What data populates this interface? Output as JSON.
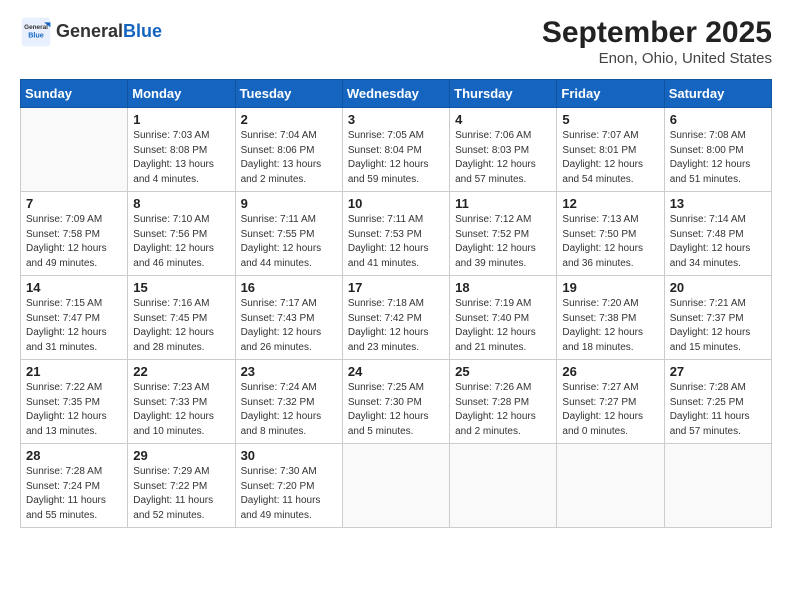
{
  "header": {
    "logo_line1": "General",
    "logo_line2": "Blue",
    "month_year": "September 2025",
    "location": "Enon, Ohio, United States"
  },
  "days_of_week": [
    "Sunday",
    "Monday",
    "Tuesday",
    "Wednesday",
    "Thursday",
    "Friday",
    "Saturday"
  ],
  "weeks": [
    [
      {
        "day": "",
        "info": ""
      },
      {
        "day": "1",
        "info": "Sunrise: 7:03 AM\nSunset: 8:08 PM\nDaylight: 13 hours\nand 4 minutes."
      },
      {
        "day": "2",
        "info": "Sunrise: 7:04 AM\nSunset: 8:06 PM\nDaylight: 13 hours\nand 2 minutes."
      },
      {
        "day": "3",
        "info": "Sunrise: 7:05 AM\nSunset: 8:04 PM\nDaylight: 12 hours\nand 59 minutes."
      },
      {
        "day": "4",
        "info": "Sunrise: 7:06 AM\nSunset: 8:03 PM\nDaylight: 12 hours\nand 57 minutes."
      },
      {
        "day": "5",
        "info": "Sunrise: 7:07 AM\nSunset: 8:01 PM\nDaylight: 12 hours\nand 54 minutes."
      },
      {
        "day": "6",
        "info": "Sunrise: 7:08 AM\nSunset: 8:00 PM\nDaylight: 12 hours\nand 51 minutes."
      }
    ],
    [
      {
        "day": "7",
        "info": "Sunrise: 7:09 AM\nSunset: 7:58 PM\nDaylight: 12 hours\nand 49 minutes."
      },
      {
        "day": "8",
        "info": "Sunrise: 7:10 AM\nSunset: 7:56 PM\nDaylight: 12 hours\nand 46 minutes."
      },
      {
        "day": "9",
        "info": "Sunrise: 7:11 AM\nSunset: 7:55 PM\nDaylight: 12 hours\nand 44 minutes."
      },
      {
        "day": "10",
        "info": "Sunrise: 7:11 AM\nSunset: 7:53 PM\nDaylight: 12 hours\nand 41 minutes."
      },
      {
        "day": "11",
        "info": "Sunrise: 7:12 AM\nSunset: 7:52 PM\nDaylight: 12 hours\nand 39 minutes."
      },
      {
        "day": "12",
        "info": "Sunrise: 7:13 AM\nSunset: 7:50 PM\nDaylight: 12 hours\nand 36 minutes."
      },
      {
        "day": "13",
        "info": "Sunrise: 7:14 AM\nSunset: 7:48 PM\nDaylight: 12 hours\nand 34 minutes."
      }
    ],
    [
      {
        "day": "14",
        "info": "Sunrise: 7:15 AM\nSunset: 7:47 PM\nDaylight: 12 hours\nand 31 minutes."
      },
      {
        "day": "15",
        "info": "Sunrise: 7:16 AM\nSunset: 7:45 PM\nDaylight: 12 hours\nand 28 minutes."
      },
      {
        "day": "16",
        "info": "Sunrise: 7:17 AM\nSunset: 7:43 PM\nDaylight: 12 hours\nand 26 minutes."
      },
      {
        "day": "17",
        "info": "Sunrise: 7:18 AM\nSunset: 7:42 PM\nDaylight: 12 hours\nand 23 minutes."
      },
      {
        "day": "18",
        "info": "Sunrise: 7:19 AM\nSunset: 7:40 PM\nDaylight: 12 hours\nand 21 minutes."
      },
      {
        "day": "19",
        "info": "Sunrise: 7:20 AM\nSunset: 7:38 PM\nDaylight: 12 hours\nand 18 minutes."
      },
      {
        "day": "20",
        "info": "Sunrise: 7:21 AM\nSunset: 7:37 PM\nDaylight: 12 hours\nand 15 minutes."
      }
    ],
    [
      {
        "day": "21",
        "info": "Sunrise: 7:22 AM\nSunset: 7:35 PM\nDaylight: 12 hours\nand 13 minutes."
      },
      {
        "day": "22",
        "info": "Sunrise: 7:23 AM\nSunset: 7:33 PM\nDaylight: 12 hours\nand 10 minutes."
      },
      {
        "day": "23",
        "info": "Sunrise: 7:24 AM\nSunset: 7:32 PM\nDaylight: 12 hours\nand 8 minutes."
      },
      {
        "day": "24",
        "info": "Sunrise: 7:25 AM\nSunset: 7:30 PM\nDaylight: 12 hours\nand 5 minutes."
      },
      {
        "day": "25",
        "info": "Sunrise: 7:26 AM\nSunset: 7:28 PM\nDaylight: 12 hours\nand 2 minutes."
      },
      {
        "day": "26",
        "info": "Sunrise: 7:27 AM\nSunset: 7:27 PM\nDaylight: 12 hours\nand 0 minutes."
      },
      {
        "day": "27",
        "info": "Sunrise: 7:28 AM\nSunset: 7:25 PM\nDaylight: 11 hours\nand 57 minutes."
      }
    ],
    [
      {
        "day": "28",
        "info": "Sunrise: 7:28 AM\nSunset: 7:24 PM\nDaylight: 11 hours\nand 55 minutes."
      },
      {
        "day": "29",
        "info": "Sunrise: 7:29 AM\nSunset: 7:22 PM\nDaylight: 11 hours\nand 52 minutes."
      },
      {
        "day": "30",
        "info": "Sunrise: 7:30 AM\nSunset: 7:20 PM\nDaylight: 11 hours\nand 49 minutes."
      },
      {
        "day": "",
        "info": ""
      },
      {
        "day": "",
        "info": ""
      },
      {
        "day": "",
        "info": ""
      },
      {
        "day": "",
        "info": ""
      }
    ]
  ]
}
